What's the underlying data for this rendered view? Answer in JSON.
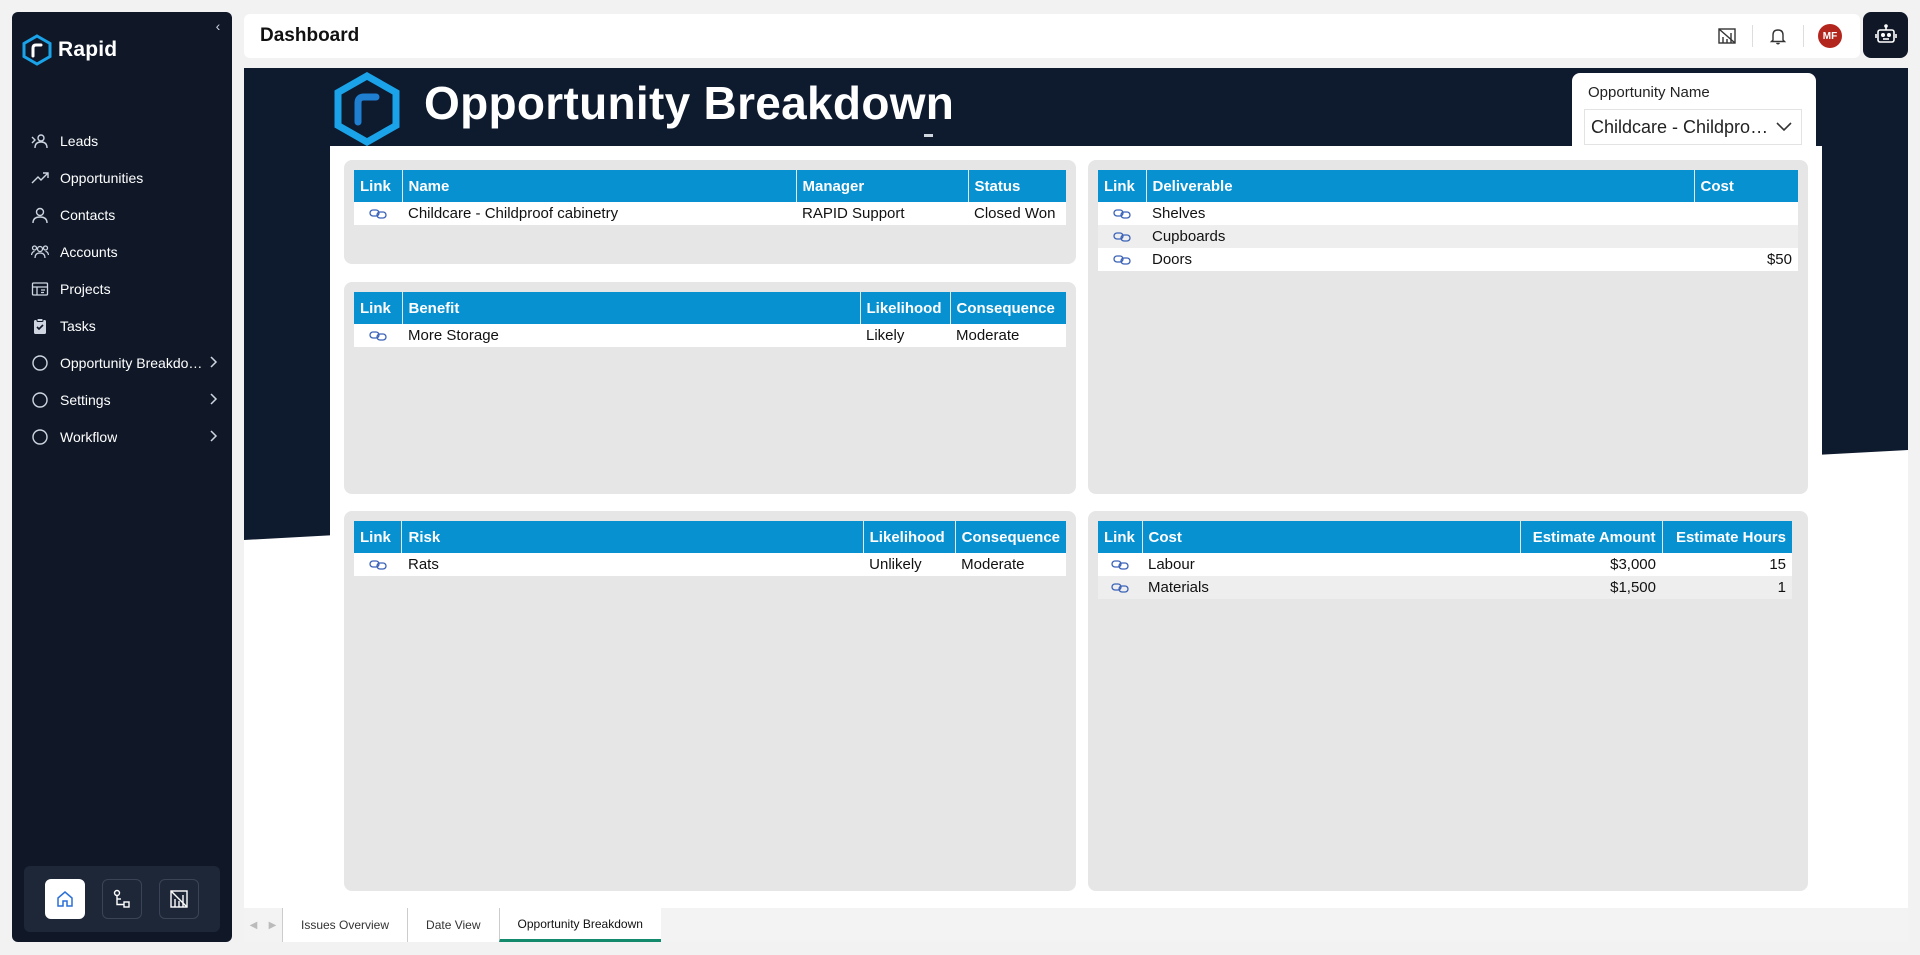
{
  "app": {
    "brand": "Rapid"
  },
  "sidebar": {
    "items": [
      {
        "label": "Leads",
        "icon": "leads-icon"
      },
      {
        "label": "Opportunities",
        "icon": "trend-icon"
      },
      {
        "label": "Contacts",
        "icon": "contact-icon"
      },
      {
        "label": "Accounts",
        "icon": "accounts-icon"
      },
      {
        "label": "Projects",
        "icon": "projects-icon"
      },
      {
        "label": "Tasks",
        "icon": "tasks-icon"
      },
      {
        "label": "Opportunity Breakdown",
        "icon": "circle-icon",
        "expandable": true
      },
      {
        "label": "Settings",
        "icon": "circle-icon",
        "expandable": true
      },
      {
        "label": "Workflow",
        "icon": "circle-icon",
        "expandable": true
      }
    ]
  },
  "header": {
    "title": "Dashboard",
    "avatar_initials": "MF"
  },
  "report": {
    "title": "Opportunity Breakdown",
    "slicer": {
      "label": "Opportunity Name",
      "value": "Childcare - Childproof cabinetry"
    },
    "opportunity_table": {
      "headers": [
        "Link",
        "Name",
        "Manager",
        "Status"
      ],
      "rows": [
        {
          "name": "Childcare - Childproof cabinetry",
          "manager": "RAPID Support",
          "status": "Closed Won"
        }
      ]
    },
    "benefit_table": {
      "headers": [
        "Link",
        "Benefit",
        "Likelihood",
        "Consequence"
      ],
      "rows": [
        {
          "benefit": "More Storage",
          "likelihood": "Likely",
          "consequence": "Moderate"
        }
      ]
    },
    "risk_table": {
      "headers": [
        "Link",
        "Risk",
        "Likelihood",
        "Consequence"
      ],
      "rows": [
        {
          "risk": "Rats",
          "likelihood": "Unlikely",
          "consequence": "Moderate"
        }
      ]
    },
    "deliverable_table": {
      "headers": [
        "Link",
        "Deliverable",
        "Cost"
      ],
      "rows": [
        {
          "deliverable": "Shelves",
          "cost": ""
        },
        {
          "deliverable": "Cupboards",
          "cost": ""
        },
        {
          "deliverable": "Doors",
          "cost": "$50"
        }
      ]
    },
    "cost_table": {
      "headers": [
        "Link",
        "Cost",
        "Estimate Amount",
        "Estimate Hours"
      ],
      "rows": [
        {
          "cost": "Labour",
          "amount": "$3,000",
          "hours": "15"
        },
        {
          "cost": "Materials",
          "amount": "$1,500",
          "hours": "1"
        }
      ]
    }
  },
  "tabs": [
    {
      "label": "Issues Overview"
    },
    {
      "label": "Date View"
    },
    {
      "label": "Opportunity Breakdown",
      "active": true
    }
  ],
  "colors": {
    "navy": "#101828",
    "header_blue": "#0891d1",
    "accent_green": "#138a6b",
    "avatar_red": "#b3261e"
  }
}
